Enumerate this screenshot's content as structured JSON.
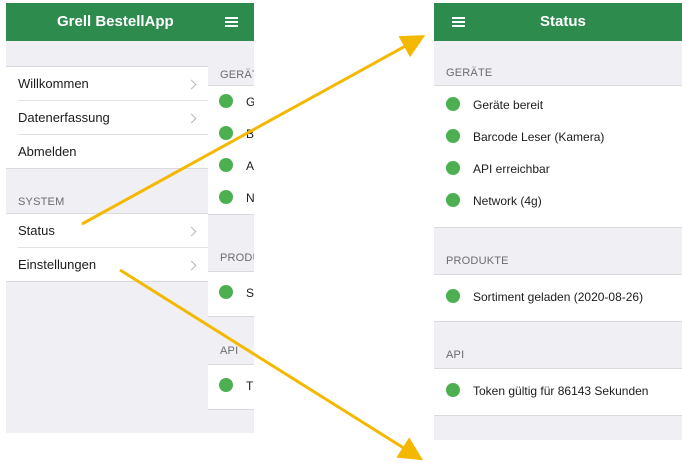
{
  "left": {
    "app_title": "Grell BestellApp",
    "menu": [
      {
        "label": "Willkommen"
      },
      {
        "label": "Datenerfassung"
      },
      {
        "label": "Abmelden"
      }
    ],
    "system_header": "SYSTEM",
    "system_menu": [
      {
        "label": "Status"
      },
      {
        "label": "Einstellungen"
      }
    ],
    "peek": {
      "section1": "GERÄTE",
      "items1": [
        "G",
        "B",
        "A",
        "N"
      ],
      "section2": "PRODUKTE",
      "items2": [
        "S"
      ],
      "section3": "API",
      "items3": [
        "T"
      ]
    }
  },
  "right": {
    "title": "Status",
    "sections": [
      {
        "header": "GERÄTE",
        "items": [
          "Geräte bereit",
          "Barcode Leser (Kamera)",
          "API erreichbar",
          "Network (4g)"
        ]
      },
      {
        "header": "PRODUKTE",
        "items": [
          "Sortiment geladen (2020-08-26)"
        ]
      },
      {
        "header": "API",
        "items": [
          "Token gültig für 86143 Sekunden"
        ]
      }
    ]
  },
  "colors": {
    "header_green": "#2e8b4e",
    "status_dot": "#4caf50",
    "arrow": "#f5b800"
  }
}
